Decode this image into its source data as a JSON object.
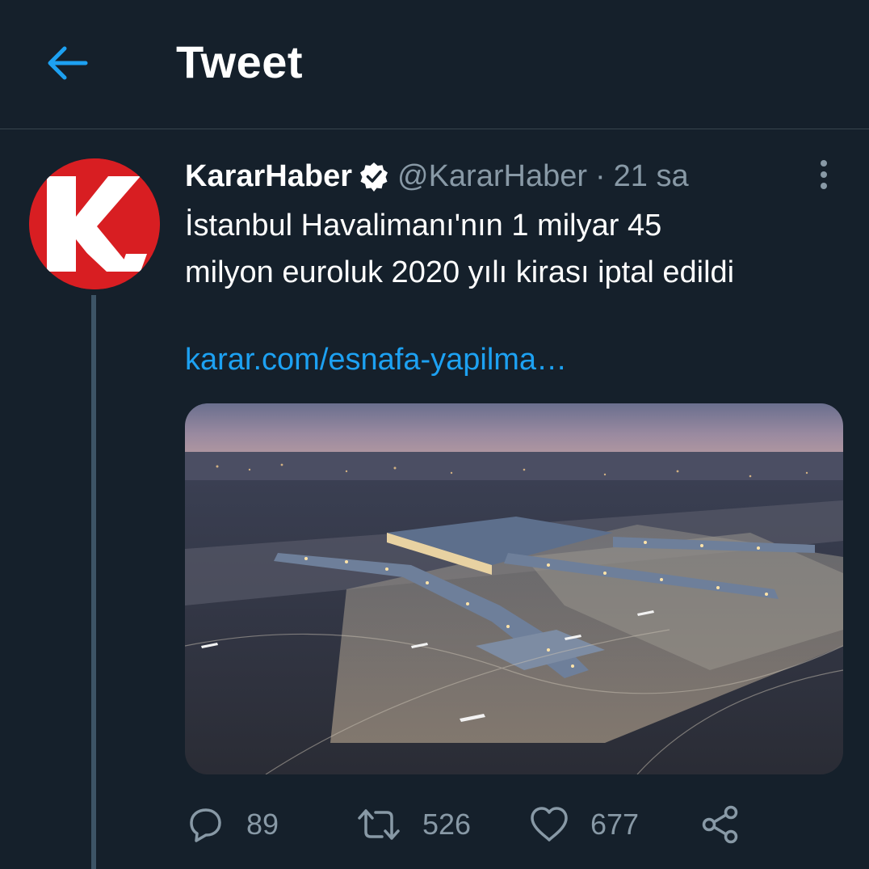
{
  "header": {
    "title": "Tweet",
    "back_icon": "arrow-left-icon",
    "accent_color": "#1da1f2"
  },
  "tweet": {
    "avatar_letter": "K.",
    "avatar_color": "#d81e22",
    "display_name": "KararHaber",
    "verified": true,
    "handle": "@KararHaber",
    "separator": "·",
    "time": "21 sa",
    "text_line1": "İstanbul Havalimanı'nın 1 milyar 45",
    "text_line2": "milyon euroluk 2020 yılı kirası iptal edildi",
    "link": "karar.com/esnafa-yapilma…",
    "media": "airport-aerial-photo"
  },
  "actions": {
    "reply_count": "89",
    "retweet_count": "526",
    "like_count": "677",
    "share_icon": "share-icon"
  }
}
